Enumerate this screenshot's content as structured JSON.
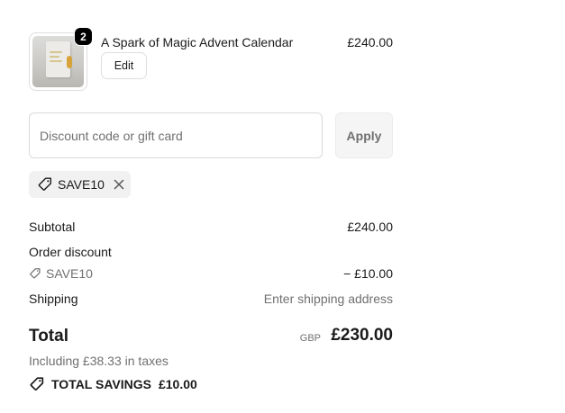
{
  "line_item": {
    "title": "A Spark of Magic Advent Calendar",
    "price": "£240.00",
    "quantity": "2",
    "edit_label": "Edit",
    "thumbnail_icon": "product-image"
  },
  "discount": {
    "placeholder": "Discount code or gift card",
    "value": "",
    "apply_label": "Apply",
    "applied_code": "SAVE10",
    "applied_code_icon": "tag-icon",
    "remove_icon": "close-icon"
  },
  "totals": {
    "subtotal_label": "Subtotal",
    "subtotal_value": "£240.00",
    "order_discount_label": "Order discount",
    "discount_code": "SAVE10",
    "discount_value": "− £10.00",
    "shipping_label": "Shipping",
    "shipping_value": "Enter shipping address",
    "total_label": "Total",
    "total_currency": "GBP",
    "total_value": "£230.00",
    "taxes_text": "Including £38.33 in taxes",
    "savings_label": "TOTAL SAVINGS",
    "savings_value": "£10.00"
  },
  "colors": {
    "text": "#1a1a1a",
    "muted": "#707070",
    "chip_bg": "#f1f1f1",
    "badge_bg": "#000000"
  }
}
